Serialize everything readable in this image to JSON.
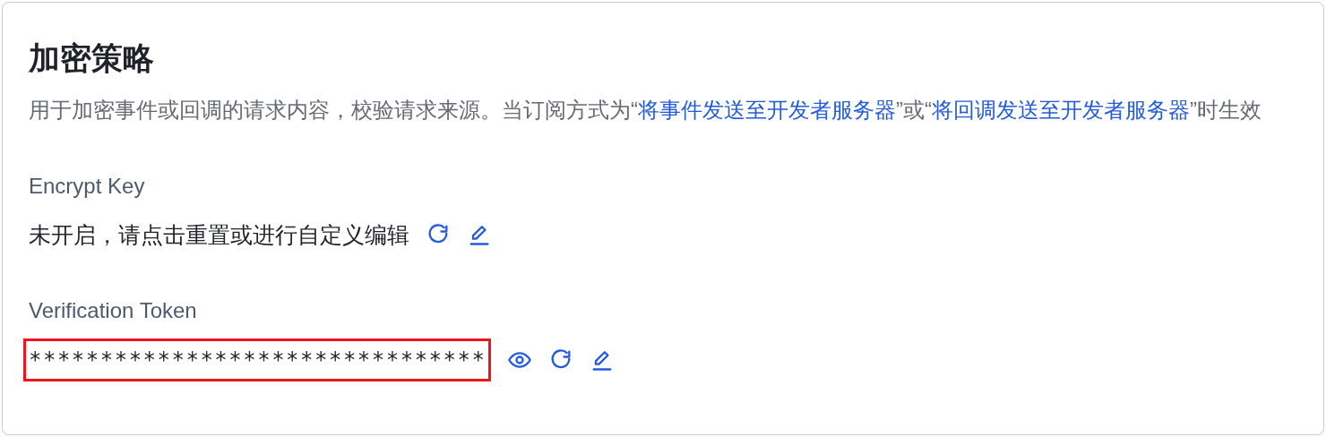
{
  "title": "加密策略",
  "description": [
    {
      "kind": "text",
      "text": "用于加密事件或回调的请求内容，校验请求来源。当订阅方式为“"
    },
    {
      "kind": "link",
      "text": "将事件发送至开发者服务器"
    },
    {
      "kind": "text",
      "text": "”或“"
    },
    {
      "kind": "link",
      "text": "将回调发送至开发者服务器"
    },
    {
      "kind": "text",
      "text": "”时生效"
    }
  ],
  "fields": [
    {
      "label": "Encrypt Key",
      "value": "未开启，请点击重置或进行自定义编辑",
      "masked": false,
      "highlighted": false,
      "actions": [
        {
          "kind": "refresh"
        },
        {
          "kind": "edit"
        }
      ]
    },
    {
      "label": "Verification Token",
      "value": "********************************",
      "masked": true,
      "highlighted": true,
      "actions": [
        {
          "kind": "view"
        },
        {
          "kind": "refresh"
        },
        {
          "kind": "edit"
        }
      ]
    }
  ]
}
